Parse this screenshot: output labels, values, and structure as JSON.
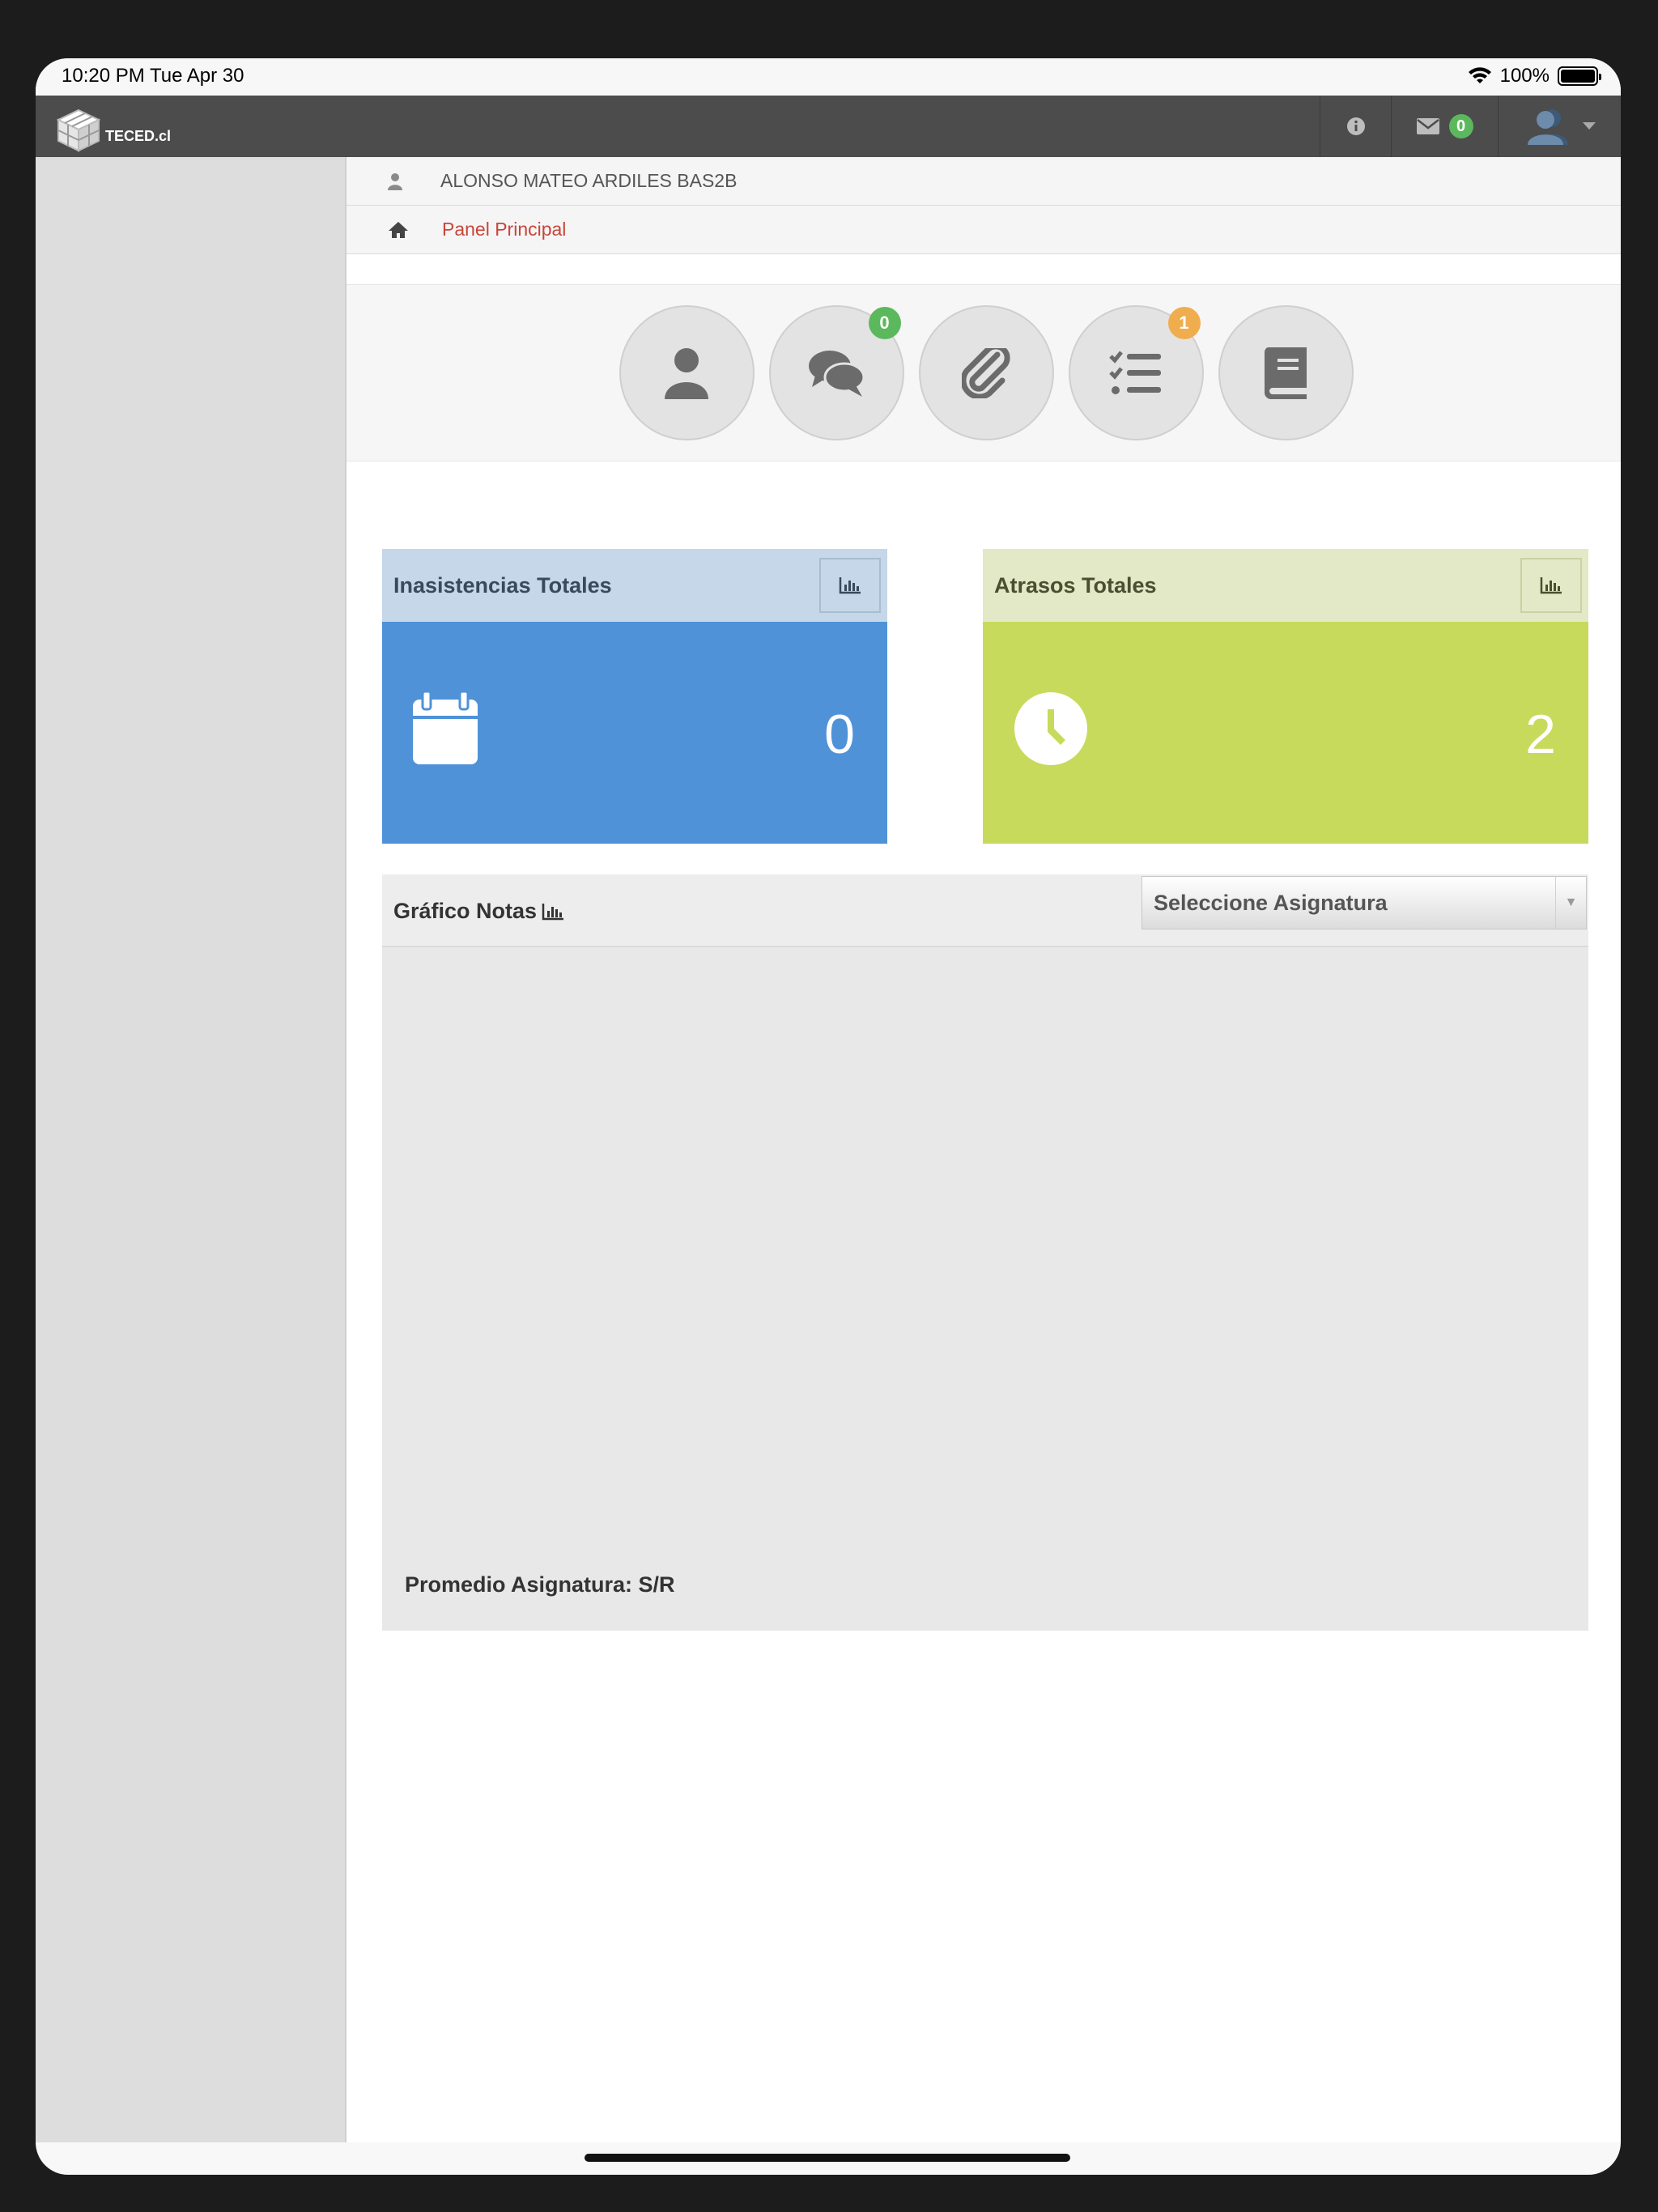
{
  "status_bar": {
    "time": "10:20 PM   Tue Apr 30",
    "battery": "100%"
  },
  "navbar": {
    "logo_text": "TECED.cl",
    "mail_count": "0"
  },
  "student": {
    "name": "ALONSO MATEO ARDILES BAS2B"
  },
  "breadcrumb": {
    "label": "Panel Principal"
  },
  "shortcuts": [
    {
      "icon": "user-icon",
      "badge": ""
    },
    {
      "icon": "comments-icon",
      "badge": "0"
    },
    {
      "icon": "paperclip-icon",
      "badge": ""
    },
    {
      "icon": "tasks-icon",
      "badge": "1"
    },
    {
      "icon": "book-icon",
      "badge": ""
    }
  ],
  "absences": {
    "title": "Inasistencias Totales",
    "value": "0",
    "color": "#4f92d8"
  },
  "delays": {
    "title": "Atrasos Totales",
    "value": "2",
    "color": "#c8da5b"
  },
  "grades": {
    "title": "Gráfico Notas",
    "select_value": "Seleccione Asignatura",
    "average": "Promedio Asignatura: S/R"
  }
}
